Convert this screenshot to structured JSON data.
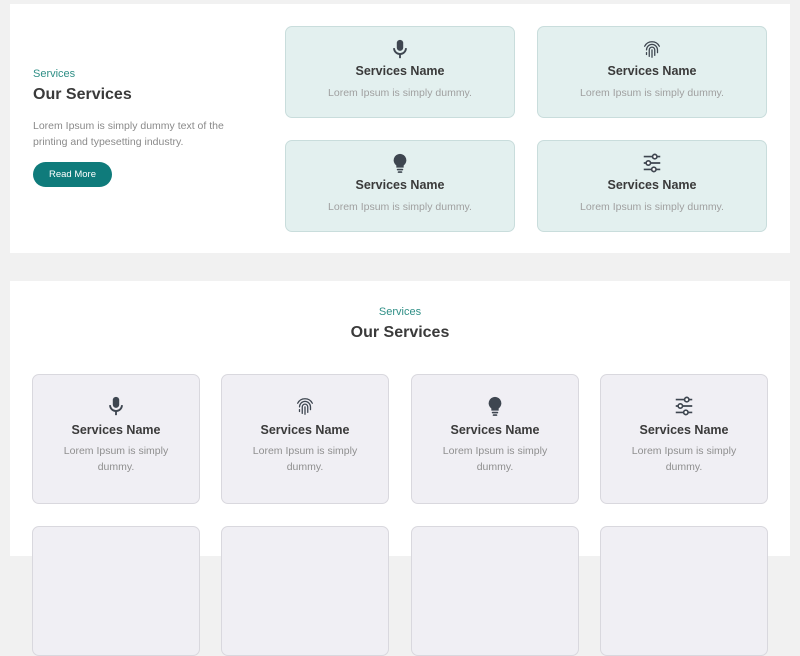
{
  "section1": {
    "eyebrow": "Services",
    "title": "Our Services",
    "description": "Lorem Ipsum is simply dummy text of the printing and typesetting industry.",
    "button_label": "Read More",
    "cards": [
      {
        "icon": "microphone-icon",
        "name": "Services Name",
        "desc": "Lorem Ipsum is simply dummy."
      },
      {
        "icon": "fingerprint-icon",
        "name": "Services Name",
        "desc": "Lorem Ipsum is simply dummy."
      },
      {
        "icon": "lightbulb-icon",
        "name": "Services Name",
        "desc": "Lorem Ipsum is simply dummy."
      },
      {
        "icon": "sliders-icon",
        "name": "Services Name",
        "desc": "Lorem Ipsum is simply dummy."
      }
    ]
  },
  "section2": {
    "eyebrow": "Services",
    "title": "Our Services",
    "cards": [
      {
        "icon": "microphone-icon",
        "name": "Services Name",
        "desc": "Lorem Ipsum is simply dummy."
      },
      {
        "icon": "fingerprint-icon",
        "name": "Services Name",
        "desc": "Lorem Ipsum is simply dummy."
      },
      {
        "icon": "lightbulb-icon",
        "name": "Services Name",
        "desc": "Lorem Ipsum is simply dummy."
      },
      {
        "icon": "sliders-icon",
        "name": "Services Name",
        "desc": "Lorem Ipsum is simply dummy."
      }
    ]
  },
  "colors": {
    "accent": "#0f7b7b",
    "eyebrow": "#2f8f86",
    "teal_card_bg": "#e3f0ef",
    "grey_card_bg": "#f0eff4",
    "page_bg": "#f1f1f1"
  }
}
